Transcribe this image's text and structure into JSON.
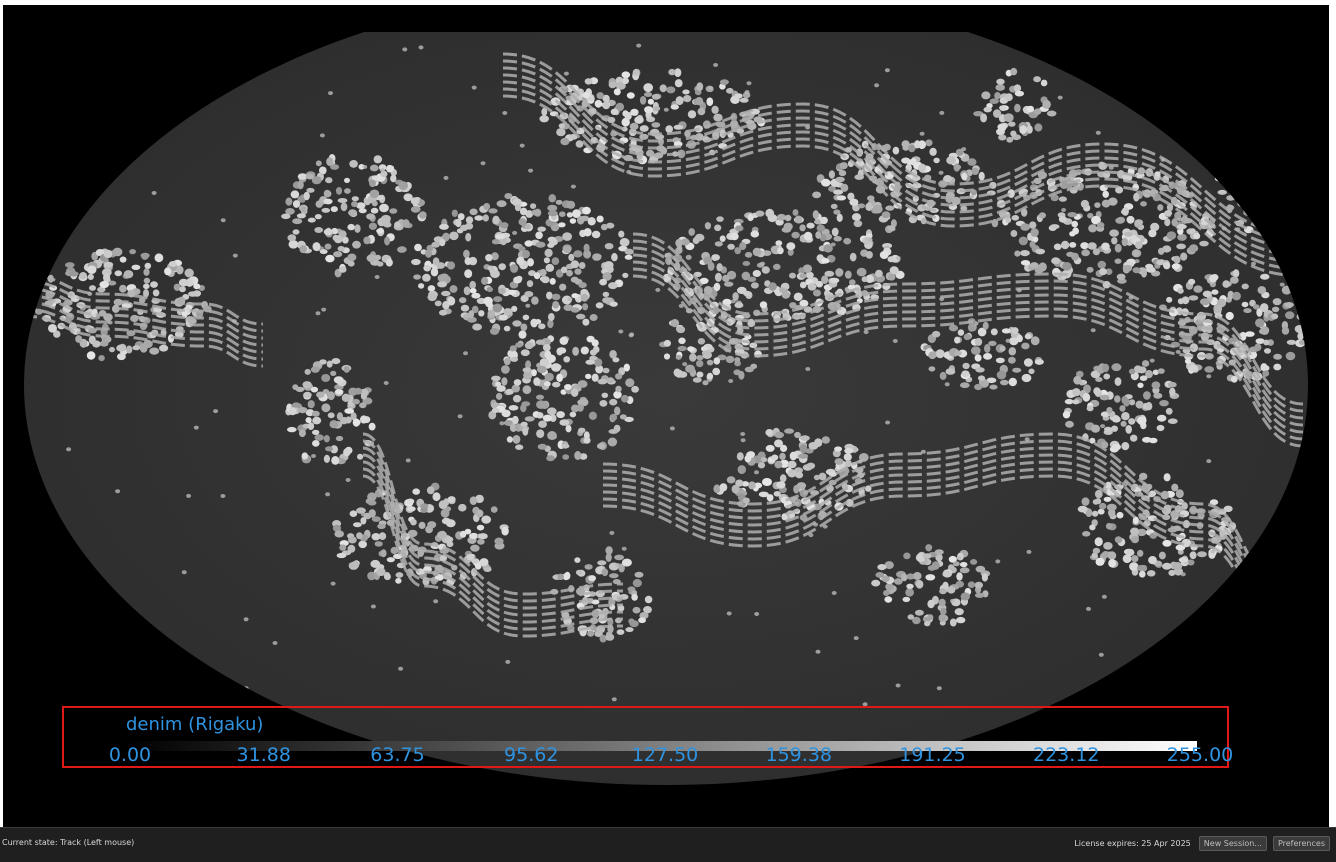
{
  "colorbar": {
    "title": "denim (Rigaku)",
    "ticks": [
      "0.00",
      "31.88",
      "63.75",
      "95.62",
      "127.50",
      "159.38",
      "191.25",
      "223.12",
      "255.00"
    ],
    "min": 0.0,
    "max": 255.0,
    "label_color": "#2f93e0",
    "frame_color": "#e01818"
  },
  "statusbar": {
    "current_state": "Current state: Track (Left mouse)",
    "license": "License expires:  25 Apr 2025",
    "new_session_label": "New Session...",
    "preferences_label": "Preferences"
  }
}
